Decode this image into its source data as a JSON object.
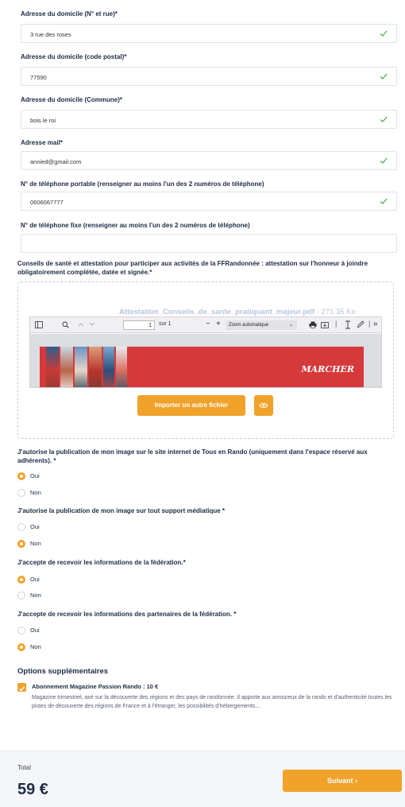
{
  "colors": {
    "accent": "#f0a22a",
    "valid": "#4caf50",
    "text": "#1f2a44"
  },
  "fields": [
    {
      "label": "Adresse du domicile (N° et rue)*",
      "value": "3 rue des roses",
      "valid": true
    },
    {
      "label": "Adresse du domicile (code postal)*",
      "value": "77590",
      "valid": true
    },
    {
      "label": "Adresse du domicile (Commune)*",
      "value": "bois le roi",
      "valid": true
    },
    {
      "label": "Adresse mail*",
      "value": "annied@gmail.com",
      "valid": true
    },
    {
      "label": "N° de téléphone portable (renseigner au moins l'un des 2 numéros de téléphone)",
      "value": "0606067777",
      "valid": true
    },
    {
      "label": "N° de téléphone fixe (renseigner au moins l'un des 2 numéros de téléphone)",
      "value": "",
      "valid": false
    }
  ],
  "health": {
    "label": "Conseils de santé et attestation pour participer aux activités de la FFRandonnée : attestation sur l'honneur à joindre obligatoirement complétée, datée et signée.*",
    "file_name": "Attestation_Conseils_de_sante_pratiquant_majeur.pdf",
    "file_size": " - 271.35 Ko",
    "viewer": {
      "page": "1",
      "page_of": "sur 1",
      "zoom": "Zoom automatique",
      "page_brand": "MARCHER"
    },
    "import_button": "Importer un autre fichier",
    "preview_icon": "eye-icon"
  },
  "questions": [
    {
      "label": "J'autorise la publication de mon image sur le site internet de Tous en Rando (uniquement dans l'espace réservé aux adhérents). *",
      "options": [
        "Oui",
        "Non"
      ],
      "selected": "Oui"
    },
    {
      "label": "J'autorise la publication de mon image sur tout support médiatique *",
      "options": [
        "Oui",
        "Non"
      ],
      "selected": "Non"
    },
    {
      "label": "J'accepte de recevoir les informations de la fédération.*",
      "options": [
        "Oui",
        "Non"
      ],
      "selected": "Oui"
    },
    {
      "label": "J'accepte de recevoir les informations des partenaires de la fédération. *",
      "options": [
        "Oui",
        "Non"
      ],
      "selected": "Non"
    }
  ],
  "options_section": {
    "title": "Options supplémentaires",
    "item": {
      "name": "Abonnement Magazine Passion Rando : 10 €",
      "description": "Magazine trimestriel, axé sur la découverte des régions et des pays de randonnée. Il apporte aux amoureux de la rando et d'authenticité toutes les pistes de découverte des régions de France et à l'étranger, les possibilités d'hébergements...",
      "checked": true
    }
  },
  "footer": {
    "total_label": "Total",
    "total_value": "59 €",
    "next_button": "Suivant ›"
  }
}
